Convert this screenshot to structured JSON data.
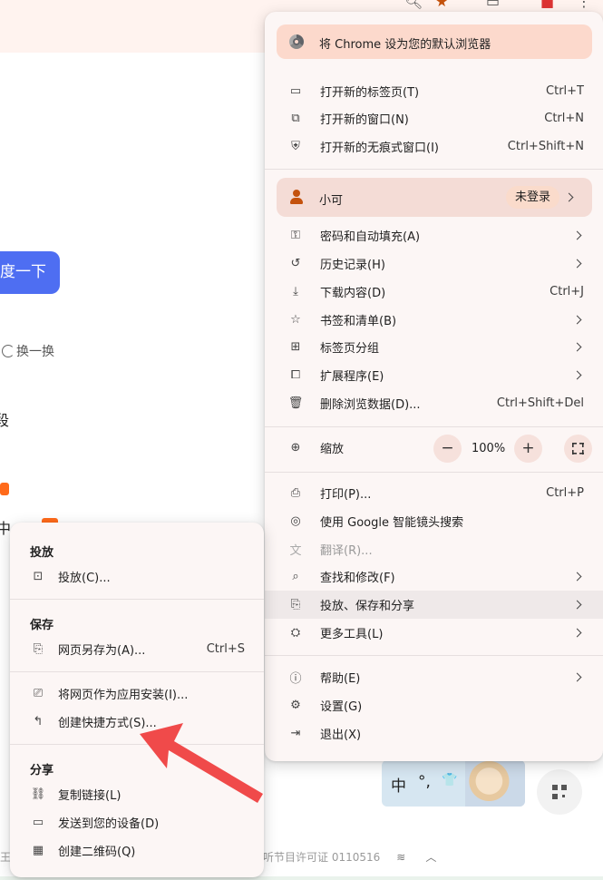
{
  "background": {
    "search_button": "度一下",
    "refresh_label": "换一换",
    "fragment_1": "段",
    "fragment_2": "中",
    "footer_left": "王:",
    "footer_right": "听节目许可证 0110516",
    "ime": {
      "char1": "中",
      "char2": "°,",
      "char3": "👕"
    }
  },
  "main_menu": {
    "banner": "将 Chrome 设为您的默认浏览器",
    "group1": [
      {
        "icon": "new-tab-icon",
        "label": "打开新的标签页(T)",
        "shortcut": "Ctrl+T"
      },
      {
        "icon": "new-window-icon",
        "label": "打开新的窗口(N)",
        "shortcut": "Ctrl+N"
      },
      {
        "icon": "incognito-icon",
        "label": "打开新的无痕式窗口(I)",
        "shortcut": "Ctrl+Shift+N"
      }
    ],
    "profile": {
      "name": "小可",
      "status": "未登录"
    },
    "group2": [
      {
        "icon": "key-icon",
        "label": "密码和自动填充(A)"
      },
      {
        "icon": "history-icon",
        "label": "历史记录(H)"
      },
      {
        "icon": "download-icon",
        "label": "下载内容(D)",
        "shortcut": "Ctrl+J"
      },
      {
        "icon": "star-icon",
        "label": "书签和清单(B)"
      },
      {
        "icon": "tab-groups-icon",
        "label": "标签页分组"
      },
      {
        "icon": "extension-icon",
        "label": "扩展程序(E)"
      },
      {
        "icon": "trash-icon",
        "label": "删除浏览数据(D)...",
        "shortcut": "Ctrl+Shift+Del"
      }
    ],
    "zoom": {
      "label": "缩放",
      "minus": "−",
      "value": "100%",
      "plus": "+"
    },
    "group3": [
      {
        "icon": "print-icon",
        "label": "打印(P)...",
        "shortcut": "Ctrl+P"
      },
      {
        "icon": "lens-icon",
        "label": "使用 Google 智能镜头搜索"
      },
      {
        "icon": "translate-icon",
        "label": "翻译(R)..."
      },
      {
        "icon": "find-icon",
        "label": "查找和修改(F)"
      },
      {
        "icon": "cast-save-share-icon",
        "label": "投放、保存和分享"
      },
      {
        "icon": "toolbox-icon",
        "label": "更多工具(L)"
      }
    ],
    "group4": [
      {
        "icon": "help-icon",
        "label": "帮助(E)"
      },
      {
        "icon": "settings-icon",
        "label": "设置(G)"
      },
      {
        "icon": "exit-icon",
        "label": "退出(X)"
      }
    ]
  },
  "sub_menu": {
    "cast_title": "投放",
    "cast_item": "投放(C)...",
    "save_title": "保存",
    "save_item": "网页另存为(A)...",
    "save_shortcut": "Ctrl+S",
    "install_item": "将网页作为应用安装(I)...",
    "shortcut_item": "创建快捷方式(S)...",
    "share_title": "分享",
    "share_items": [
      "复制链接(L)",
      "发送到您的设备(D)",
      "创建二维码(Q)"
    ]
  },
  "colors": {
    "menu_bg": "#fcf6f5",
    "banner_bg": "#fcd9cc",
    "profile_bg": "#f4dcd6",
    "accent_orange": "#c4520d",
    "search_blue": "#4e6ef2",
    "arrow_red": "#f04a4a"
  }
}
